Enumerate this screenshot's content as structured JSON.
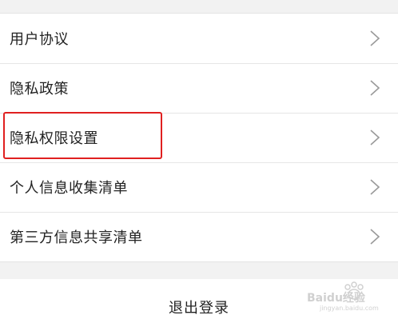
{
  "menu": {
    "items": [
      {
        "label": "用户协议"
      },
      {
        "label": "隐私政策"
      },
      {
        "label": "隐私权限设置"
      },
      {
        "label": "个人信息收集清单"
      },
      {
        "label": "第三方信息共享清单"
      }
    ]
  },
  "logout": {
    "label": "退出登录"
  },
  "watermark": {
    "brand": "Baidu经验",
    "url": "jingyan.baidu.com"
  },
  "colors": {
    "background": "#f2f2f2",
    "card": "#ffffff",
    "text": "#222222",
    "chevron": "#9a9a9a",
    "highlight": "#e02020"
  },
  "icons": {
    "chevron": "chevron-right-icon"
  }
}
